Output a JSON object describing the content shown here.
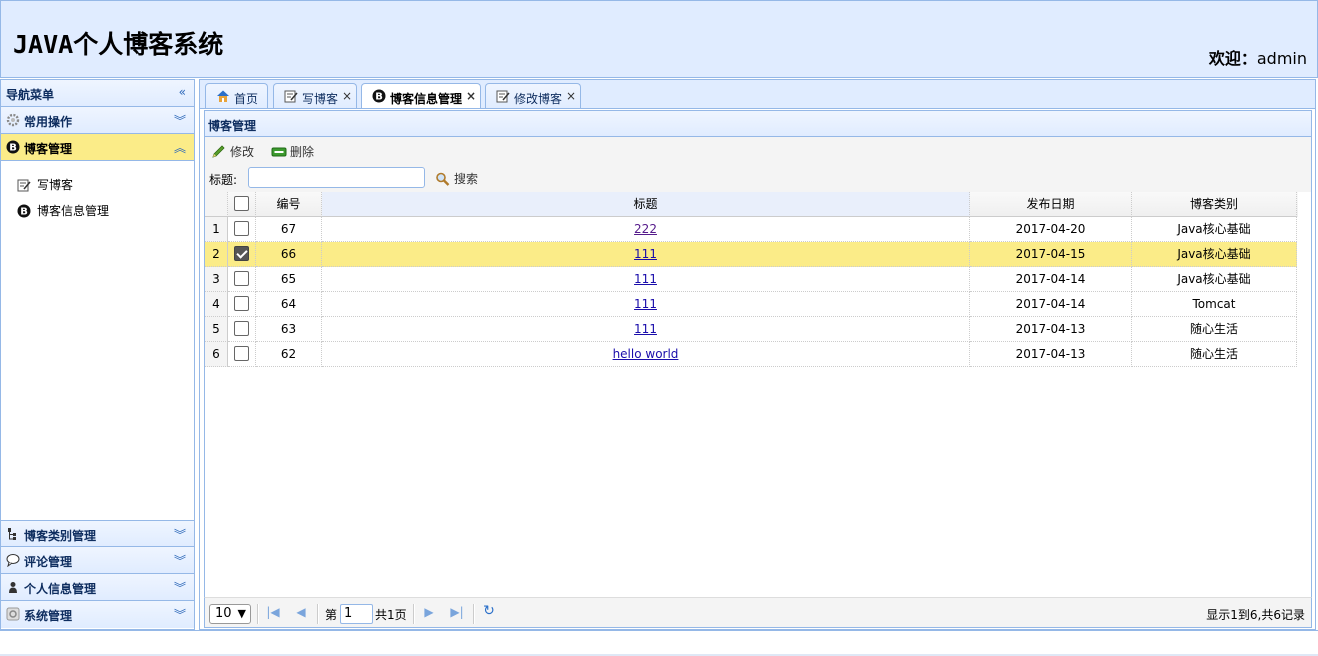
{
  "header": {
    "title": "JAVA个人博客系统",
    "welcome_label": "欢迎：",
    "username": "admin"
  },
  "sidebar": {
    "nav_title": "导航菜单",
    "panels": [
      {
        "label": "常用操作",
        "icon": "gear-icon"
      },
      {
        "label": "博客管理",
        "icon": "blog-icon",
        "selected": true,
        "items": [
          {
            "label": "写博客",
            "icon": "edit-icon"
          },
          {
            "label": "博客信息管理",
            "icon": "blog-icon"
          }
        ]
      },
      {
        "label": "博客类别管理",
        "icon": "category-icon"
      },
      {
        "label": "评论管理",
        "icon": "comment-icon"
      },
      {
        "label": "个人信息管理",
        "icon": "user-icon"
      },
      {
        "label": "系统管理",
        "icon": "system-icon"
      }
    ]
  },
  "tabs": [
    {
      "label": "首页",
      "icon": "home-icon",
      "closable": false
    },
    {
      "label": "写博客",
      "icon": "edit-icon",
      "closable": true
    },
    {
      "label": "博客信息管理",
      "icon": "blog-icon",
      "closable": true,
      "active": true
    },
    {
      "label": "修改博客",
      "icon": "edit-icon",
      "closable": true
    }
  ],
  "panel": {
    "title": "博客管理",
    "toolbar": {
      "edit_label": "修改",
      "delete_label": "删除",
      "search_label": "标题:",
      "search_value": "",
      "search_button": "搜索"
    },
    "columns": [
      "编号",
      "标题",
      "发布日期",
      "博客类别"
    ],
    "rows": [
      {
        "n": "1",
        "id": "67",
        "title": "222",
        "date": "2017-04-20",
        "category": "Java核心基础",
        "checked": false
      },
      {
        "n": "2",
        "id": "66",
        "title": "111",
        "date": "2017-04-15",
        "category": "Java核心基础",
        "checked": true
      },
      {
        "n": "3",
        "id": "65",
        "title": "111",
        "date": "2017-04-14",
        "category": "Java核心基础",
        "checked": false
      },
      {
        "n": "4",
        "id": "64",
        "title": "111",
        "date": "2017-04-14",
        "category": "Tomcat",
        "checked": false
      },
      {
        "n": "5",
        "id": "63",
        "title": "111",
        "date": "2017-04-13",
        "category": "随心生活",
        "checked": false
      },
      {
        "n": "6",
        "id": "62",
        "title": "hello world",
        "date": "2017-04-13",
        "category": "随心生活",
        "checked": false
      }
    ],
    "pager": {
      "page_size": "10",
      "page_prefix": "第",
      "page_value": "1",
      "page_total": "共1页",
      "info": "显示1到6,共6记录"
    }
  },
  "colors": {
    "header_bg": "#e0ecff",
    "border": "#95b8e7",
    "selected": "#fbec88"
  }
}
